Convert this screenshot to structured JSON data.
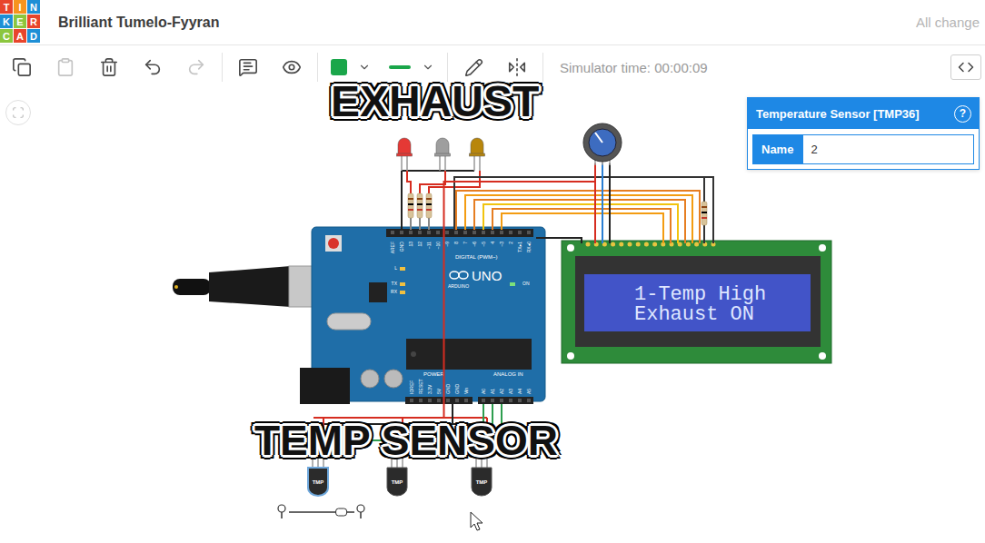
{
  "header": {
    "logo": [
      {
        "letter": "T",
        "color": "#e8452c"
      },
      {
        "letter": "I",
        "color": "#f7941d"
      },
      {
        "letter": "N",
        "color": "#1e8fd6"
      },
      {
        "letter": "K",
        "color": "#1e8fd6"
      },
      {
        "letter": "E",
        "color": "#8cc63e"
      },
      {
        "letter": "R",
        "color": "#e8452c"
      },
      {
        "letter": "C",
        "color": "#8cc63e"
      },
      {
        "letter": "A",
        "color": "#e8452c"
      },
      {
        "letter": "D",
        "color": "#1e8fd6"
      }
    ],
    "title": "Brilliant Tumelo-Fyyran",
    "save_status": "All change"
  },
  "toolbar": {
    "tools": [
      {
        "disabled": false
      },
      {
        "disabled": true
      },
      {
        "disabled": false
      },
      {
        "disabled": false
      },
      {
        "disabled": true
      },
      {
        "disabled": false
      },
      {
        "disabled": false
      }
    ],
    "color_picker": {
      "color": "#1aa64a"
    },
    "line_style": {
      "color": "#1aa64a"
    },
    "simulator_time": "Simulator time: 00:00:09"
  },
  "inspector": {
    "title": "Temperature Sensor [TMP36]",
    "help": "?",
    "fields": [
      {
        "label": "Name",
        "value": "2"
      }
    ]
  },
  "annotations": [
    "EXHAUST",
    "TEMP SENSOR"
  ],
  "circuit": {
    "board": {
      "model": "UNO",
      "brand": "ARDUINO",
      "digital_header": "DIGITAL (PWM~)",
      "analog_header": "ANALOG IN",
      "power_header": "POWER",
      "indicators": [
        "L",
        "TX",
        "RX",
        "ON"
      ],
      "digital_pins": [
        "AREF",
        "GND",
        "13",
        "12",
        "~11",
        "~10",
        "~9",
        "8",
        "7",
        "~6",
        "~5",
        "4",
        "~3",
        "2",
        "TX▸1",
        "RX◂0"
      ],
      "power_pins": [
        "IOREF",
        "RESET",
        "3.3V",
        "5V",
        "GND",
        "GND",
        "Vin"
      ],
      "analog_pins": [
        "A0",
        "A1",
        "A2",
        "A3",
        "A4",
        "A5"
      ]
    },
    "lcd": {
      "lines": [
        "1-Temp High",
        "Exhaust ON"
      ]
    },
    "leds": [
      {
        "color": "#e53935"
      },
      {
        "color": "#9e9e9e"
      },
      {
        "color": "#b8860b"
      }
    ],
    "sensors": [
      {
        "label": "TMP",
        "selected": true
      },
      {
        "label": "TMP",
        "selected": false
      },
      {
        "label": "TMP",
        "selected": false
      }
    ],
    "temperature_slider": {
      "level": 0.8
    }
  }
}
